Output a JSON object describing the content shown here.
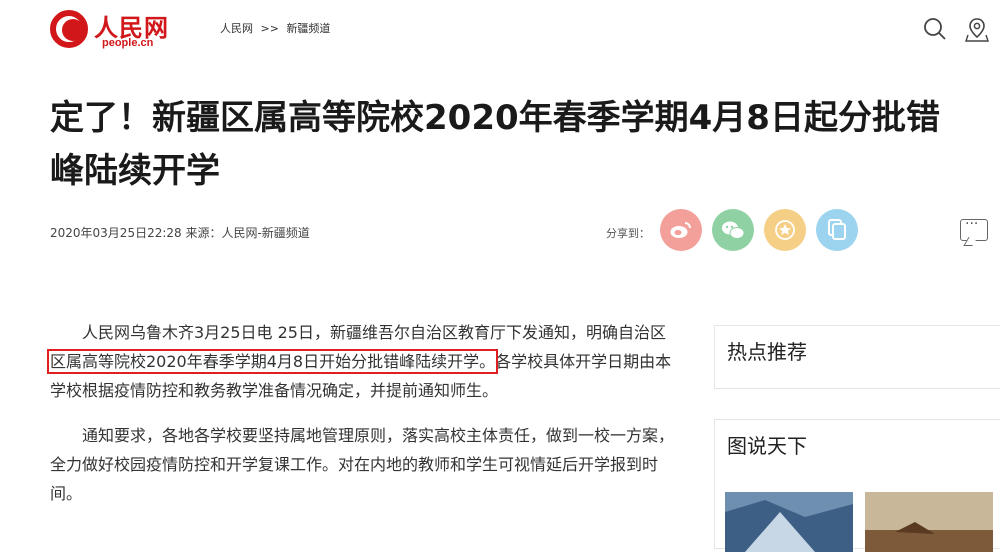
{
  "header": {
    "logo_cn": "人民网",
    "logo_en": "people.cn",
    "breadcrumb": [
      "人民网",
      ">>",
      "新疆频道"
    ]
  },
  "article": {
    "title": "定了！新疆区属高等院校2020年春季学期4月8日起分批错峰陆续开学",
    "meta": "2020年03月25日22:28  来源：人民网-新疆频道",
    "share_label": "分享到：",
    "paragraphs": [
      {
        "before": "人民网乌鲁木齐3月25日电 25日，新疆维吾尔自治区教育厅下发通知，明确自治区",
        "highlight": "区属高等院校2020年春季学期4月8日开始分批错峰陆续开学。",
        "after": "各学校具体开学日期由本学校根据疫情防控和教务教学准备情况确定，并提前通知师生。"
      },
      {
        "text": "通知要求，各地各学校要坚持属地管理原则，落实高校主体责任，做到一校一方案，全力做好校园疫情防控和开学复课工作。对在内地的教师和学生可视情延后开学报到时间。"
      }
    ]
  },
  "sidebar": {
    "hot": "热点推荐",
    "pictures": "图说天下"
  },
  "colors": {
    "brand_red": "#d2171b",
    "share_weibo": "#f3a09a",
    "share_wechat": "#8fd1a3",
    "share_fav": "#f5cf86",
    "share_copy": "#9cd3ee"
  },
  "icons": [
    "search-icon",
    "location-icon",
    "weibo-icon",
    "wechat-icon",
    "star-icon",
    "copy-icon",
    "comment-icon"
  ]
}
